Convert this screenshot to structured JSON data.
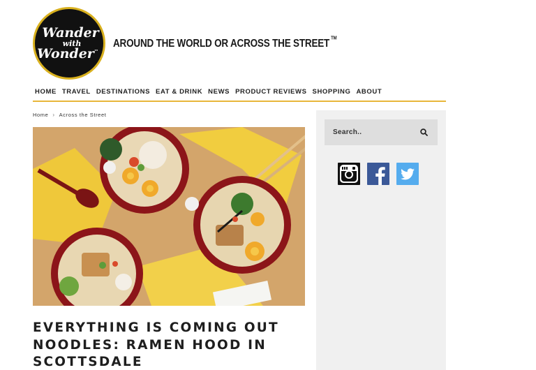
{
  "header": {
    "logo": {
      "line1": "Wander",
      "line2": "with",
      "line3": "Wonder",
      "tm": "™"
    },
    "tagline": "AROUND THE WORLD OR ACROSS THE STREET",
    "tagline_tm": "TM"
  },
  "nav": {
    "items": [
      {
        "label": "HOME"
      },
      {
        "label": "TRAVEL"
      },
      {
        "label": "DESTINATIONS"
      },
      {
        "label": "EAT & DRINK"
      },
      {
        "label": "NEWS"
      },
      {
        "label": "PRODUCT REVIEWS"
      },
      {
        "label": "SHOPPING"
      },
      {
        "label": "ABOUT"
      }
    ],
    "underline_color": "#e8b63a"
  },
  "breadcrumb": {
    "home": "Home",
    "separator": "›",
    "current": "Across the Street"
  },
  "post": {
    "title": "EVERYTHING IS COMING OUT NOODLES: RAMEN HOOD IN SCOTTSDALE",
    "hero_icon": "ramen-bowls-photo"
  },
  "sidebar": {
    "search_placeholder": "Search..",
    "search_icon": "search-icon",
    "social": [
      {
        "name": "instagram-icon",
        "color": "#111111"
      },
      {
        "name": "facebook-icon",
        "color": "#3b5998"
      },
      {
        "name": "twitter-icon",
        "color": "#55acee"
      }
    ]
  }
}
